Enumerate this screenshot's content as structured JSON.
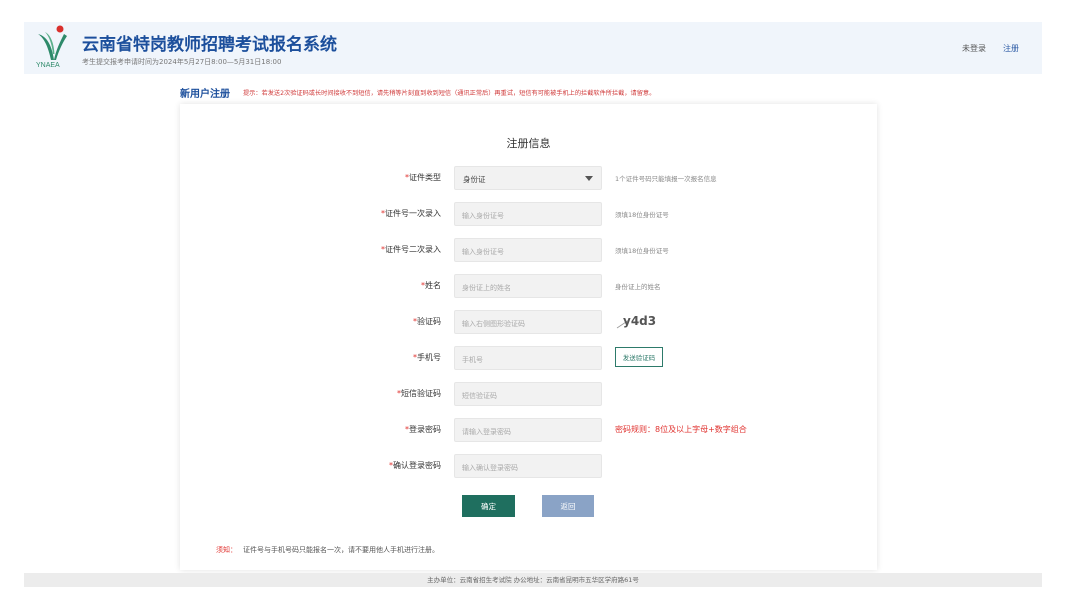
{
  "header": {
    "logo_text": "YNAEA",
    "title": "云南省特岗教师招聘考试报名系统",
    "subtitle": "考生提交报考申请时间为2024年5月27日8:00—5月31日18:00",
    "login_status": "未登录",
    "register_link": "注册",
    "colors": {
      "title": "#1c4f9c",
      "logo_green": "#2e8a6a",
      "logo_red": "#d9302c"
    }
  },
  "section": {
    "title": "新用户注册",
    "tip": "提示：若发送2次验证码或长时间接收不到短信，请先稍等片刻直到收到短信（通讯正常后）再重试，短信有可能被手机上的拦截软件所拦截，请留意。"
  },
  "form": {
    "title": "注册信息",
    "required_mark": "*",
    "id_type": {
      "label": "证件类型",
      "value": "身份证",
      "hint": "1个证件号码只能填报一次报名信息"
    },
    "id_first": {
      "label": "证件号一次录入",
      "placeholder": "输入身份证号",
      "hint": "须填18位身份证号"
    },
    "id_second": {
      "label": "证件号二次录入",
      "placeholder": "输入身份证号",
      "hint": "须填18位身份证号"
    },
    "name": {
      "label": "姓名",
      "placeholder": "身份证上的姓名",
      "hint": "身份证上的姓名"
    },
    "captcha": {
      "label": "验证码",
      "placeholder": "输入右侧图形验证码",
      "image_text": "y4d3"
    },
    "phone": {
      "label": "手机号",
      "placeholder": "手机号",
      "send_button": "发送验证码"
    },
    "sms_code": {
      "label": "短信验证码",
      "placeholder": "短信验证码"
    },
    "password": {
      "label": "登录密码",
      "placeholder": "请输入登录密码",
      "hint": "密码规则：8位及以上字母+数字组合"
    },
    "confirm_password": {
      "label": "确认登录密码",
      "placeholder": "输入确认登录密码"
    },
    "submit_label": "确定",
    "back_label": "返回",
    "notice_label": "须知：",
    "notice_text": "证件号与手机号码只能报名一次，请不要用他人手机进行注册。"
  },
  "footer": {
    "text": "主办单位：云南省招生考试院 办公地址：云南省昆明市五华区学府路61号"
  },
  "colors": {
    "primary_button": "#1f6f5f",
    "secondary_button": "#8aa3c6",
    "required": "#e0322f",
    "header_bg": "#f0f5fb"
  }
}
